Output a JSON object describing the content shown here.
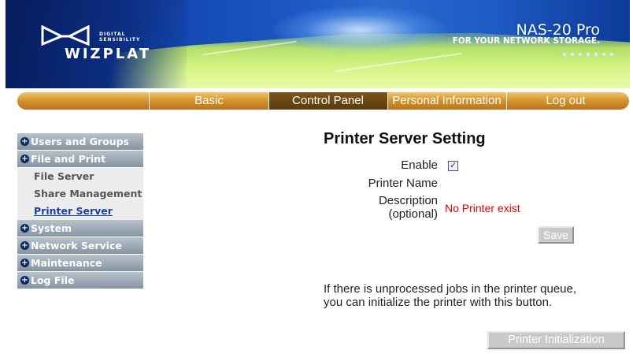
{
  "banner": {
    "brand": "WIZPLAT",
    "tagline_1": "DIGITAL",
    "tagline_2": "SENSIBILITY",
    "product_title": "NAS-20 Pro",
    "product_subtitle": "FOR YOUR NETWORK STORAGE."
  },
  "nav": {
    "tabs": [
      "Basic",
      "Control Panel",
      "Personal Information",
      "Log out"
    ],
    "active": "Control Panel"
  },
  "sidebar": {
    "categories": [
      {
        "label": "Users and Groups"
      },
      {
        "label": "File and Print",
        "items": [
          "File Server",
          "Share Management",
          "Printer Server"
        ]
      },
      {
        "label": "System"
      },
      {
        "label": "Network Service"
      },
      {
        "label": "Maintenance"
      },
      {
        "label": "Log File"
      }
    ],
    "active_item": "Printer Server"
  },
  "main": {
    "title": "Printer Server Setting",
    "enable_label": "Enable",
    "enable_checked": true,
    "printer_name_label": "Printer Name",
    "description_label_1": "Description",
    "description_label_2": "(optional)",
    "status_text": "No Printer exist",
    "save_label": "Save",
    "note_line_1": "If there is unprocessed jobs in the printer queue,",
    "note_line_2": "you can initialize the printer with this button.",
    "init_label": "Printer Initialization"
  },
  "colors": {
    "nav_orange": "#d4922a",
    "nav_active": "#5a3a0e",
    "sidebar_gray": "#8593a2",
    "error_red": "#e00000",
    "link_blue": "#1a3fa8"
  }
}
